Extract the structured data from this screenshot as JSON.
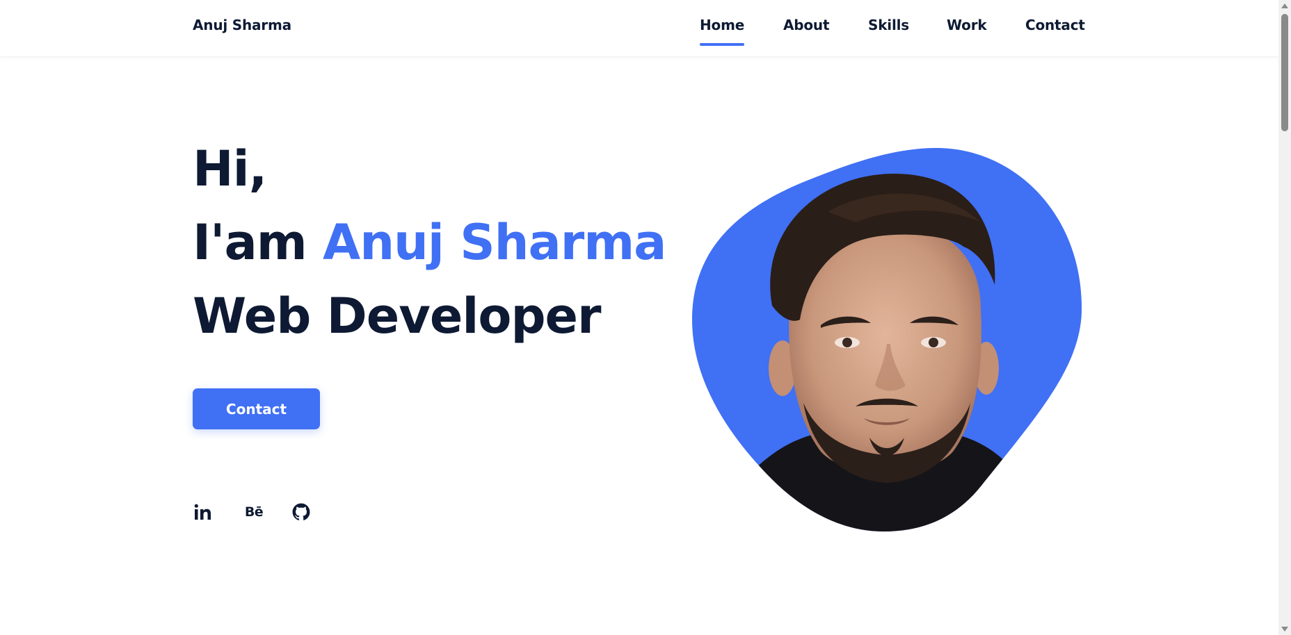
{
  "header": {
    "brand": "Anuj Sharma",
    "nav": [
      {
        "label": "Home",
        "active": true
      },
      {
        "label": "About",
        "active": false
      },
      {
        "label": "Skills",
        "active": false
      },
      {
        "label": "Work",
        "active": false
      },
      {
        "label": "Contact",
        "active": false
      }
    ]
  },
  "hero": {
    "greeting": "Hi,",
    "intro_prefix": "I'am ",
    "name": "Anuj Sharma",
    "role": "Web Developer",
    "cta_label": "Contact"
  },
  "social": [
    {
      "icon": "linkedin-icon",
      "glyph": "in"
    },
    {
      "icon": "behance-icon",
      "glyph": "Bē"
    },
    {
      "icon": "github-icon",
      "glyph": ""
    }
  ],
  "portrait": {
    "blob_color": "#4070f4"
  },
  "colors": {
    "accent": "#4070f4",
    "text": "#0e1a33"
  }
}
